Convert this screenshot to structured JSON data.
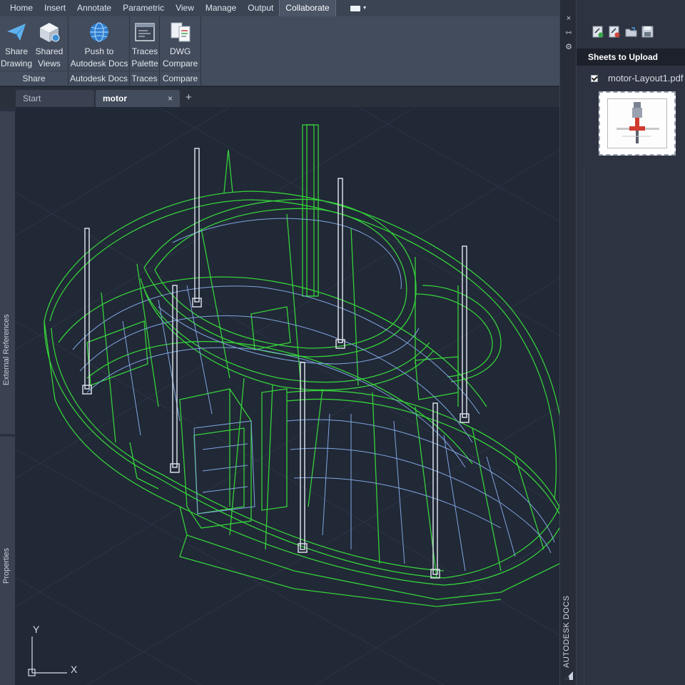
{
  "menu": {
    "tabs": [
      "Home",
      "Insert",
      "Annotate",
      "Parametric",
      "View",
      "Manage",
      "Output",
      "Collaborate"
    ],
    "active_tab": "Collaborate"
  },
  "ribbon": {
    "panels": [
      {
        "title": "Share",
        "tools": [
          {
            "line1": "Share",
            "line2": "Drawing",
            "icon": "paper-plane-icon"
          },
          {
            "line1": "Shared",
            "line2": "Views",
            "icon": "cube-icon"
          }
        ]
      },
      {
        "title": "Autodesk Docs",
        "tools": [
          {
            "line1": "Push to",
            "line2": "Autodesk Docs",
            "icon": "globe-icon"
          }
        ]
      },
      {
        "title": "Traces",
        "tools": [
          {
            "line1": "Traces",
            "line2": "Palette",
            "icon": "traces-icon"
          }
        ]
      },
      {
        "title": "Compare",
        "tools": [
          {
            "line1": "DWG",
            "line2": "Compare",
            "icon": "compare-icon"
          }
        ]
      }
    ]
  },
  "doc_tabs": {
    "start": "Start",
    "active": "motor",
    "close": "×",
    "add": "+"
  },
  "left_palettes": {
    "external_references": "External References",
    "properties": "Properties"
  },
  "ucs": {
    "x_label": "X",
    "y_label": "Y"
  },
  "side_strip": {
    "close": "×",
    "brand": "AUTODESK DOCS"
  },
  "docs_panel": {
    "header": "Sheets to Upload",
    "file_name": "motor-Layout1.pdf",
    "file_checked": true
  },
  "colors": {
    "wire_green": "#35d13a",
    "wire_blue": "#7fa6e0",
    "wire_white": "#d8dde5",
    "viewport_bg": "#212836",
    "ribbon_bg": "#434c5c"
  }
}
